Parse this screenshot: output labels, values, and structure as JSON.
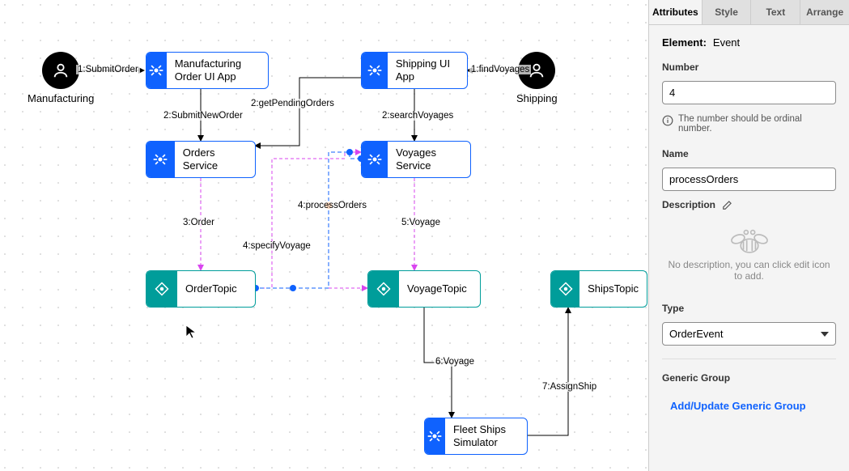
{
  "actors": {
    "manufacturing": "Manufacturing",
    "shipping": "Shipping"
  },
  "nodes": {
    "mfg_ui": "Manufacturing Order UI App",
    "ship_ui": "Shipping UI App",
    "orders_svc": "Orders Service",
    "voyages_svc": "Voyages Service",
    "order_topic": "OrderTopic",
    "voyage_topic": "VoyageTopic",
    "ships_topic": "ShipsTopic",
    "fleet_sim": "Fleet Ships Simulator"
  },
  "edges": {
    "e1": "1:SubmitOrder",
    "e2a": "2:SubmitNewOrder",
    "e2b": "2:getPendingOrders",
    "e2c": "2:searchVoyages",
    "e1b": "1:findVoyages",
    "e3": "3:Order",
    "e4a": "4:specifyVoyage",
    "e4b": "4:processOrders",
    "e5": "5:Voyage",
    "e6": "6:Voyage",
    "e7": "7:AssignShip"
  },
  "tabs": {
    "attributes": "Attributes",
    "style": "Style",
    "text": "Text",
    "arrange": "Arrange"
  },
  "panel": {
    "element_label": "Element:",
    "element_value": "Event",
    "number_label": "Number",
    "number_value": "4",
    "number_hint": "The number should be ordinal number.",
    "name_label": "Name",
    "name_value": "processOrders",
    "description_label": "Description",
    "description_empty": "No description, you can click edit icon to add.",
    "type_label": "Type",
    "type_value": "OrderEvent",
    "generic_group_label": "Generic Group",
    "generic_group_action": "Add/Update Generic Group"
  }
}
